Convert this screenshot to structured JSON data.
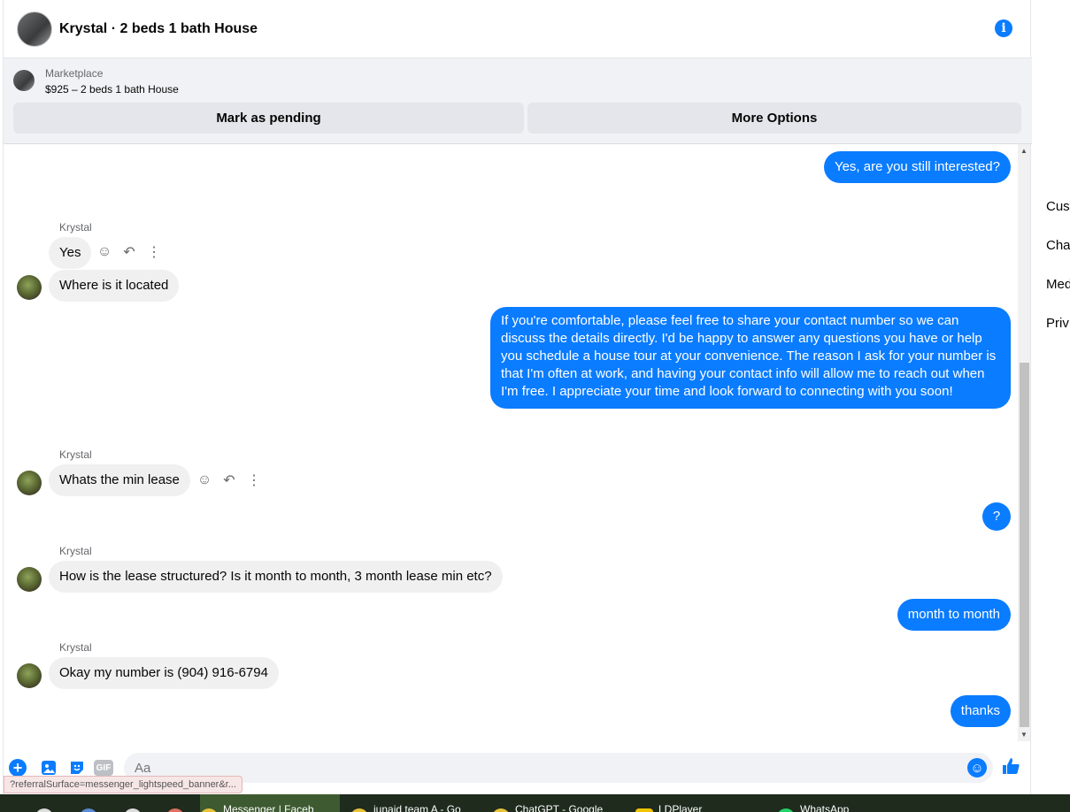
{
  "header": {
    "title": "Krystal · 2 beds 1 bath House",
    "info_icon": "i"
  },
  "marketplace": {
    "label": "Marketplace",
    "listing": "$925 – 2 beds 1 bath House",
    "pending_label": "Mark as pending",
    "options_label": "More Options"
  },
  "messages": {
    "m1": "Yes, are you still interested?",
    "s1": "Krystal",
    "m2": "Yes",
    "m3": "Where is it located",
    "m4": "If you're comfortable, please feel free to share your contact number so we can discuss the details directly. I'd be happy to answer any questions you have or help you schedule a house tour at your convenience. The reason I ask for your number is that I'm often at work, and having your contact info will allow me to reach out when I'm free. I appreciate your time and look forward to connecting with you soon!",
    "s2": "Krystal",
    "m5": "Whats the min lease",
    "m6": "?",
    "s3": "Krystal",
    "m7": "How is the lease structured? Is it month to month, 3 month lease min etc?",
    "m8": "month to month",
    "s4": "Krystal",
    "m9": "Okay my number is (904) 916-6794",
    "m10": "thanks"
  },
  "composer": {
    "placeholder": "Aa",
    "gif_label": "GIF"
  },
  "status_url": "?referralSurface=messenger_lightspeed_banner&r...",
  "side_menu": [
    "Cust",
    "Cha",
    "Med",
    "Priv"
  ],
  "taskbar": {
    "items": [
      "Messenger | Faceb",
      "junaid team A - Go",
      "ChatGPT - Google",
      "LDPlayer",
      "WhatsApp"
    ]
  }
}
